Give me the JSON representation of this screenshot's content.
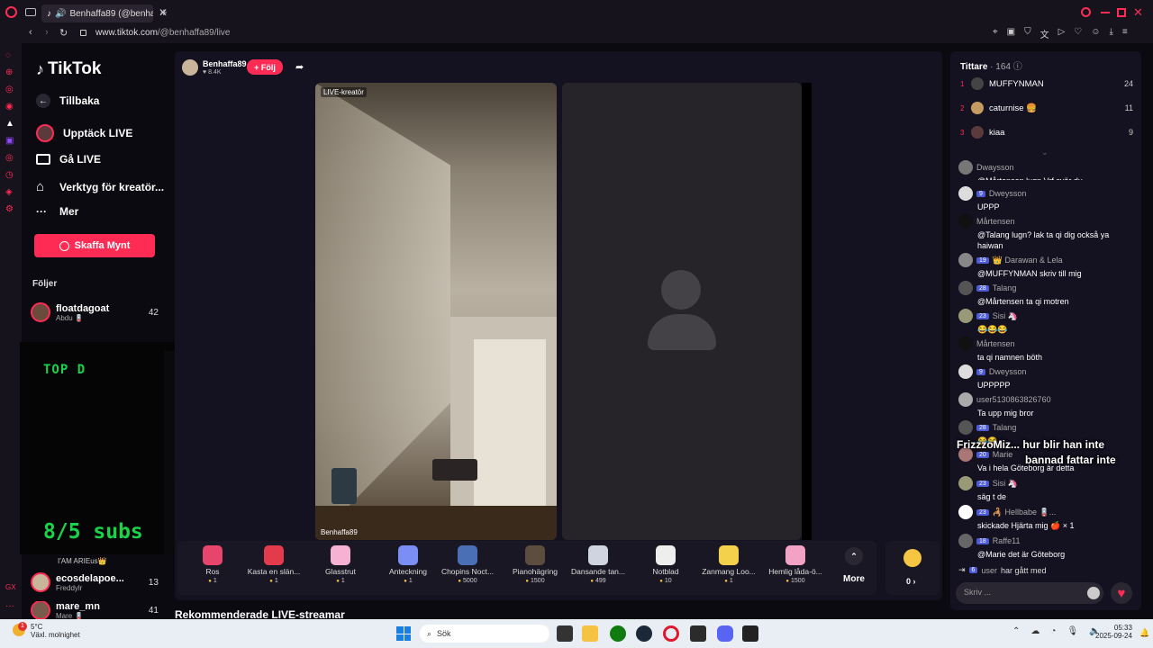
{
  "browser": {
    "tab_title": "Benhaffa89 (@benhaff",
    "url_host": "www.tiktok.com",
    "url_path": "/@benhaffa89/live"
  },
  "sidebar": {
    "logo": "TikTok",
    "back": "Tillbaka",
    "nav": [
      "Upptäck LIVE",
      "Gå LIVE",
      "Verktyg för kreatör...",
      "Mer"
    ],
    "coins_button": "Skaffa Mynt",
    "following_title": "Följer",
    "following": [
      {
        "name": "floatdagoat",
        "sub": "Abdu 🪫",
        "count": "42"
      },
      {
        "name": "ecosdelapoe...",
        "sub": "Freddyl​r",
        "count": "13"
      },
      {
        "name": "mare_mn",
        "sub": "Mare 🪫",
        "count": "41"
      }
    ],
    "partial_text": "I'AM ARIEus👑"
  },
  "overlay": {
    "top_text": "TOP D",
    "subs_text": "8/5 subs"
  },
  "stream": {
    "host_name": "Benhaffa89",
    "host_likes": "♥ 8.4K",
    "follow_button": "+ Följ",
    "creator_label": "LIVE-kreatör",
    "host_label": "Benhaffa89"
  },
  "gifts": [
    {
      "name": "Ros",
      "price": "1",
      "color": "#e8456c"
    },
    {
      "name": "Kasta en slän...",
      "price": "1",
      "color": "#e43b4c"
    },
    {
      "name": "Glasstrut",
      "price": "1",
      "color": "#f6b1d3"
    },
    {
      "name": "Anteckning",
      "price": "1",
      "color": "#7a8ef5"
    },
    {
      "name": "Chopins Noct...",
      "price": "5000",
      "color": "#4a6fb5"
    },
    {
      "name": "Pianohägring",
      "price": "1500",
      "color": "#5d4d3f"
    },
    {
      "name": "Dansande tan...",
      "price": "499",
      "color": "#cfd4e0"
    },
    {
      "name": "Notblad",
      "price": "10",
      "color": "#eeeeee"
    },
    {
      "name": "Zanmang Loo...",
      "price": "1",
      "color": "#f3d14a"
    },
    {
      "name": "Hemlig låda-ö...",
      "price": "1500",
      "color": "#f2a3c5"
    }
  ],
  "gift_more": "More",
  "coins": "0 ›",
  "recommended_title": "Rekommenderade LIVE-streamar",
  "viewers": {
    "title": "Tittare",
    "count": "· 164",
    "top": [
      {
        "rank": "1",
        "name": "MUFFYNMAN",
        "count": "24",
        "color": "#444"
      },
      {
        "rank": "2",
        "name": "caturnise 🍔",
        "count": "11",
        "color": "#c59b61"
      },
      {
        "rank": "3",
        "name": "kiaa",
        "count": "9",
        "color": "#5a3a3a"
      }
    ]
  },
  "chat": [
    {
      "user": "Dwaysson",
      "badge": "",
      "text": "@Mårtensen lugn Vrf svär du",
      "color": "#777"
    },
    {
      "user": "Dweysson",
      "badge": "9",
      "text": "UPPP",
      "color": "#ddd"
    },
    {
      "user": "Mårtensen",
      "badge": "",
      "text": "@Talang lugn? lak ta qi dig också ya haiwan",
      "color": "#111"
    },
    {
      "user": "👑 Darawan & Lela",
      "badge": "19",
      "text": "@MUFFYNMAN skriv till mig",
      "color": "#888"
    },
    {
      "user": "Talang",
      "badge": "28",
      "text": "@Mårtensen ta qi motren",
      "color": "#555"
    },
    {
      "user": "Sisi 🦄",
      "badge": "23",
      "text": "😂😂😂",
      "color": "#997"
    },
    {
      "user": "Mårtensen",
      "badge": "",
      "text": "ta qi namnen böth",
      "color": "#111"
    },
    {
      "user": "Dweysson",
      "badge": "9",
      "text": "UPPPPP",
      "color": "#ddd"
    },
    {
      "user": "user5130863826760",
      "badge": "",
      "text": "Ta upp mig bror",
      "color": "#aaa"
    },
    {
      "user": "Talang",
      "badge": "28",
      "text": "😂😂",
      "color": "#555"
    },
    {
      "user": "Marie",
      "badge": "20",
      "text": "Va i hela Göteborg är detta",
      "color": "#a77"
    },
    {
      "user": "Sisi 🦄",
      "badge": "23",
      "text": "säg t de",
      "color": "#997"
    },
    {
      "user": "🦂 Hellbabe 🪫...",
      "badge": "23",
      "text": "skickade Hjärta mig 🍎 × 1",
      "color": "#fff"
    },
    {
      "user": "Raffe11",
      "badge": "18",
      "text": "@Marie det är Göteborg",
      "color": "#666"
    }
  ],
  "joined": {
    "badge": "6",
    "user": "user",
    "text": "har gått med"
  },
  "chat_overlay": [
    "FrizzzoMiz...  hur blir han inte",
    "bannad fattar inte"
  ],
  "chat_input_placeholder": "Skriv ...",
  "taskbar": {
    "weather_temp": "5°C",
    "weather_desc": "Växl. molnighet",
    "search": "Sök",
    "time": "05:33",
    "date": "2025-09-24",
    "badge": "1"
  }
}
